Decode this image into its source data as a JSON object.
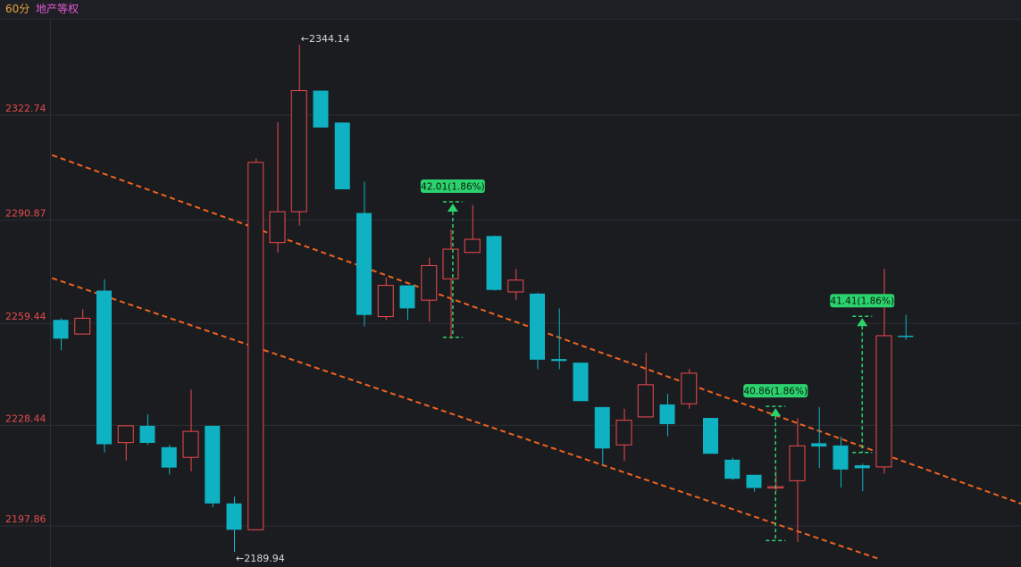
{
  "header": {
    "period_label": "60分",
    "symbol_label": "地产等权"
  },
  "colors": {
    "up": "#f0494c",
    "down": "#0fb2c2",
    "grid": "#2c2d33",
    "axis_text": "#e54b4b",
    "trendline": "#f0631e",
    "annotation": "#2bd26d",
    "background": "#1b1c20"
  },
  "chart_data": {
    "type": "candlestick",
    "y_ticks": [
      "2322.74",
      "2290.87",
      "2259.44",
      "2228.44",
      "2197.86"
    ],
    "ylim": [
      2188.0,
      2352.0
    ],
    "max_label": "2344.14",
    "min_label": "2189.94",
    "candles": [
      {
        "o": 2260.5,
        "c": 2254.8,
        "h": 2261.0,
        "l": 2251.3
      },
      {
        "o": 2256.2,
        "c": 2261.0,
        "h": 2263.8,
        "l": 2256.2
      },
      {
        "o": 2269.4,
        "c": 2222.7,
        "h": 2272.9,
        "l": 2220.2
      },
      {
        "o": 2223.2,
        "c": 2228.3,
        "h": 2228.5,
        "l": 2217.8
      },
      {
        "o": 2228.3,
        "c": 2223.1,
        "h": 2231.8,
        "l": 2222.5
      },
      {
        "o": 2221.8,
        "c": 2215.6,
        "h": 2222.5,
        "l": 2213.5
      },
      {
        "o": 2218.7,
        "c": 2226.6,
        "h": 2239.3,
        "l": 2214.5
      },
      {
        "o": 2228.3,
        "c": 2204.7,
        "h": 2228.3,
        "l": 2203.5
      },
      {
        "o": 2204.7,
        "c": 2196.7,
        "h": 2206.8,
        "l": 2189.94
      },
      {
        "o": 2196.7,
        "c": 2308.4,
        "h": 2309.6,
        "l": 2196.7
      },
      {
        "o": 2284.0,
        "c": 2293.4,
        "h": 2320.6,
        "l": 2281.0
      },
      {
        "o": 2293.4,
        "c": 2330.2,
        "h": 2344.14,
        "l": 2289.2
      },
      {
        "o": 2330.2,
        "c": 2319.0,
        "h": 2330.2,
        "l": 2319.0
      },
      {
        "o": 2320.5,
        "c": 2300.2,
        "h": 2320.6,
        "l": 2300.2
      },
      {
        "o": 2293.0,
        "c": 2262.0,
        "h": 2302.5,
        "l": 2258.5
      },
      {
        "o": 2261.5,
        "c": 2271.0,
        "h": 2273.4,
        "l": 2260.5
      },
      {
        "o": 2271.0,
        "c": 2264.0,
        "h": 2271.0,
        "l": 2260.5
      },
      {
        "o": 2266.5,
        "c": 2277.0,
        "h": 2279.4,
        "l": 2260.0
      },
      {
        "o": 2273.0,
        "c": 2282.0,
        "h": 2288.0,
        "l": 2254.8
      },
      {
        "o": 2281.0,
        "c": 2285.0,
        "h": 2295.4,
        "l": 2280.8
      },
      {
        "o": 2286.0,
        "c": 2269.6,
        "h": 2286.2,
        "l": 2269.4
      },
      {
        "o": 2269.0,
        "c": 2272.6,
        "h": 2276.0,
        "l": 2266.5
      },
      {
        "o": 2268.5,
        "c": 2248.4,
        "h": 2268.8,
        "l": 2245.5
      },
      {
        "o": 2248.6,
        "c": 2248.0,
        "h": 2264.0,
        "l": 2245.5
      },
      {
        "o": 2247.5,
        "c": 2235.8,
        "h": 2247.5,
        "l": 2235.8
      },
      {
        "o": 2234.0,
        "c": 2221.4,
        "h": 2234.0,
        "l": 2216.6
      },
      {
        "o": 2222.5,
        "c": 2230.0,
        "h": 2233.5,
        "l": 2217.6
      },
      {
        "o": 2231.0,
        "c": 2240.8,
        "h": 2250.5,
        "l": 2231.0
      },
      {
        "o": 2234.8,
        "c": 2228.8,
        "h": 2238.0,
        "l": 2225.1
      },
      {
        "o": 2235.0,
        "c": 2244.3,
        "h": 2245.6,
        "l": 2233.5
      },
      {
        "o": 2230.7,
        "c": 2219.8,
        "h": 2230.7,
        "l": 2219.8
      },
      {
        "o": 2218.0,
        "c": 2212.2,
        "h": 2218.6,
        "l": 2211.8
      },
      {
        "o": 2213.4,
        "c": 2209.4,
        "h": 2213.4,
        "l": 2208.2
      },
      {
        "o": 2209.4,
        "c": 2209.8,
        "h": 2214.5,
        "l": 2208.4
      },
      {
        "o": 2211.6,
        "c": 2222.2,
        "h": 2230.6,
        "l": 2193.0
      },
      {
        "o": 2223.0,
        "c": 2222.0,
        "h": 2234.0,
        "l": 2215.5
      },
      {
        "o": 2222.3,
        "c": 2215.0,
        "h": 2225.0,
        "l": 2209.5
      },
      {
        "o": 2216.3,
        "c": 2215.4,
        "h": 2216.8,
        "l": 2208.4
      },
      {
        "o": 2215.8,
        "c": 2255.7,
        "h": 2276.0,
        "l": 2213.8
      },
      {
        "o": 2255.7,
        "c": 2255.5,
        "h": 2262.0,
        "l": 2254.5
      }
    ],
    "trendlines": [
      {
        "from": {
          "i": -0.4,
          "y": 2310.6
        },
        "to": {
          "i": 44.6,
          "y": 2204.0
        }
      },
      {
        "from": {
          "i": -0.4,
          "y": 2273.2
        },
        "to": {
          "i": 37.7,
          "y": 2188.0
        }
      }
    ],
    "annotations": [
      {
        "label": "42.01(1.86%)",
        "i": 18.1,
        "y_low": 2255.2,
        "y_high": 2296.4
      },
      {
        "label": "40.86(1.86%)",
        "i": 33.0,
        "y_low": 2193.4,
        "y_high": 2234.2
      },
      {
        "label": "41.41(1.86%)",
        "i": 37.0,
        "y_low": 2220.2,
        "y_high": 2261.6
      }
    ]
  }
}
